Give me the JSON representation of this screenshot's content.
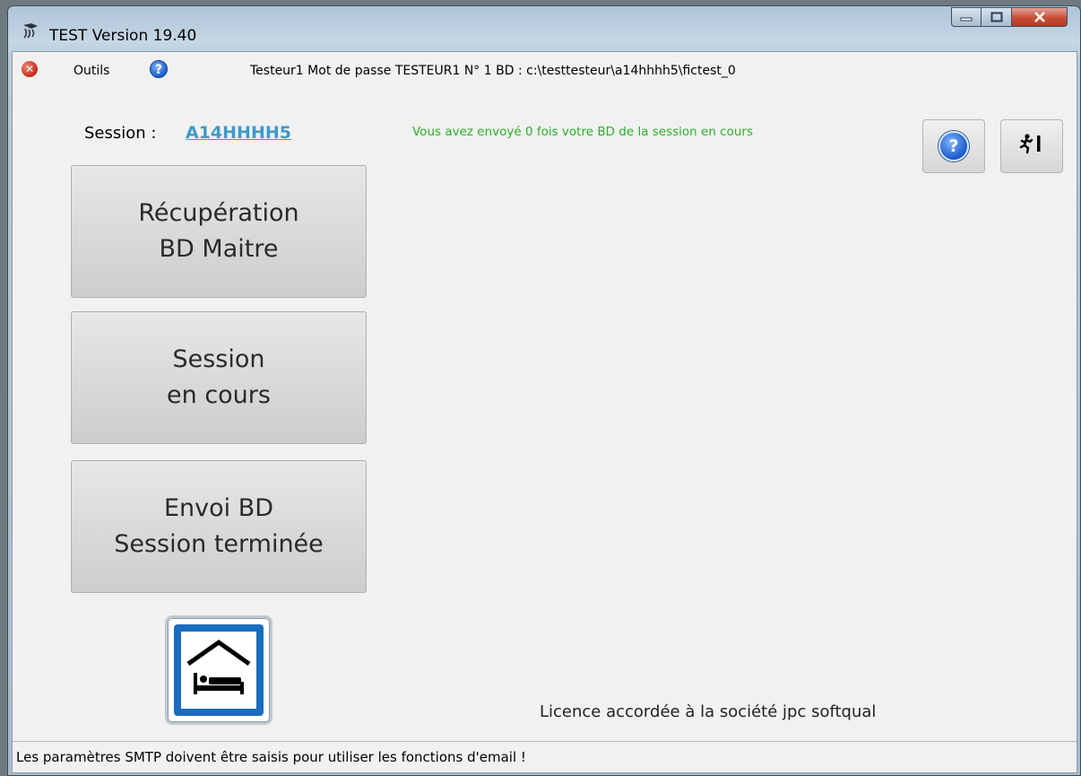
{
  "window": {
    "title": "TEST Version 19.40",
    "app_icon": "app-logo-icon",
    "controls": {
      "minimize": "—",
      "maximize": "□",
      "close": "X"
    }
  },
  "menu": {
    "close_icon": "x-circle-icon",
    "outils_label": "Outils",
    "help_icon": "?",
    "info": "Testeur1 Mot de passe TESTEUR1 N° 1  BD : c:\\testtesteur\\a14hhhh5\\fictest_0"
  },
  "session": {
    "label": "Session :",
    "code": "A14HHHH5",
    "sent_info": "Vous avez envoyé 0 fois votre BD de la session en cours"
  },
  "toolbar": {
    "help_glyph": "?",
    "exit_glyph": "🏃I"
  },
  "buttons": [
    {
      "line1": "Récupération",
      "line2": "BD Maitre"
    },
    {
      "line1": "Session",
      "line2": "en cours"
    },
    {
      "line1": "Envoi BD",
      "line2": "Session terminée"
    }
  ],
  "logo_icon": "hotel-bed-icon",
  "licence": "Licence accordée à la société  jpc softqual",
  "status": "Les paramètres SMTP doivent être saisis pour utiliser les fonctions d'email !",
  "colors": {
    "session_code": "#3d9ac9",
    "sent_info": "#2bb02b",
    "logo_blue": "#1a6cbf"
  }
}
